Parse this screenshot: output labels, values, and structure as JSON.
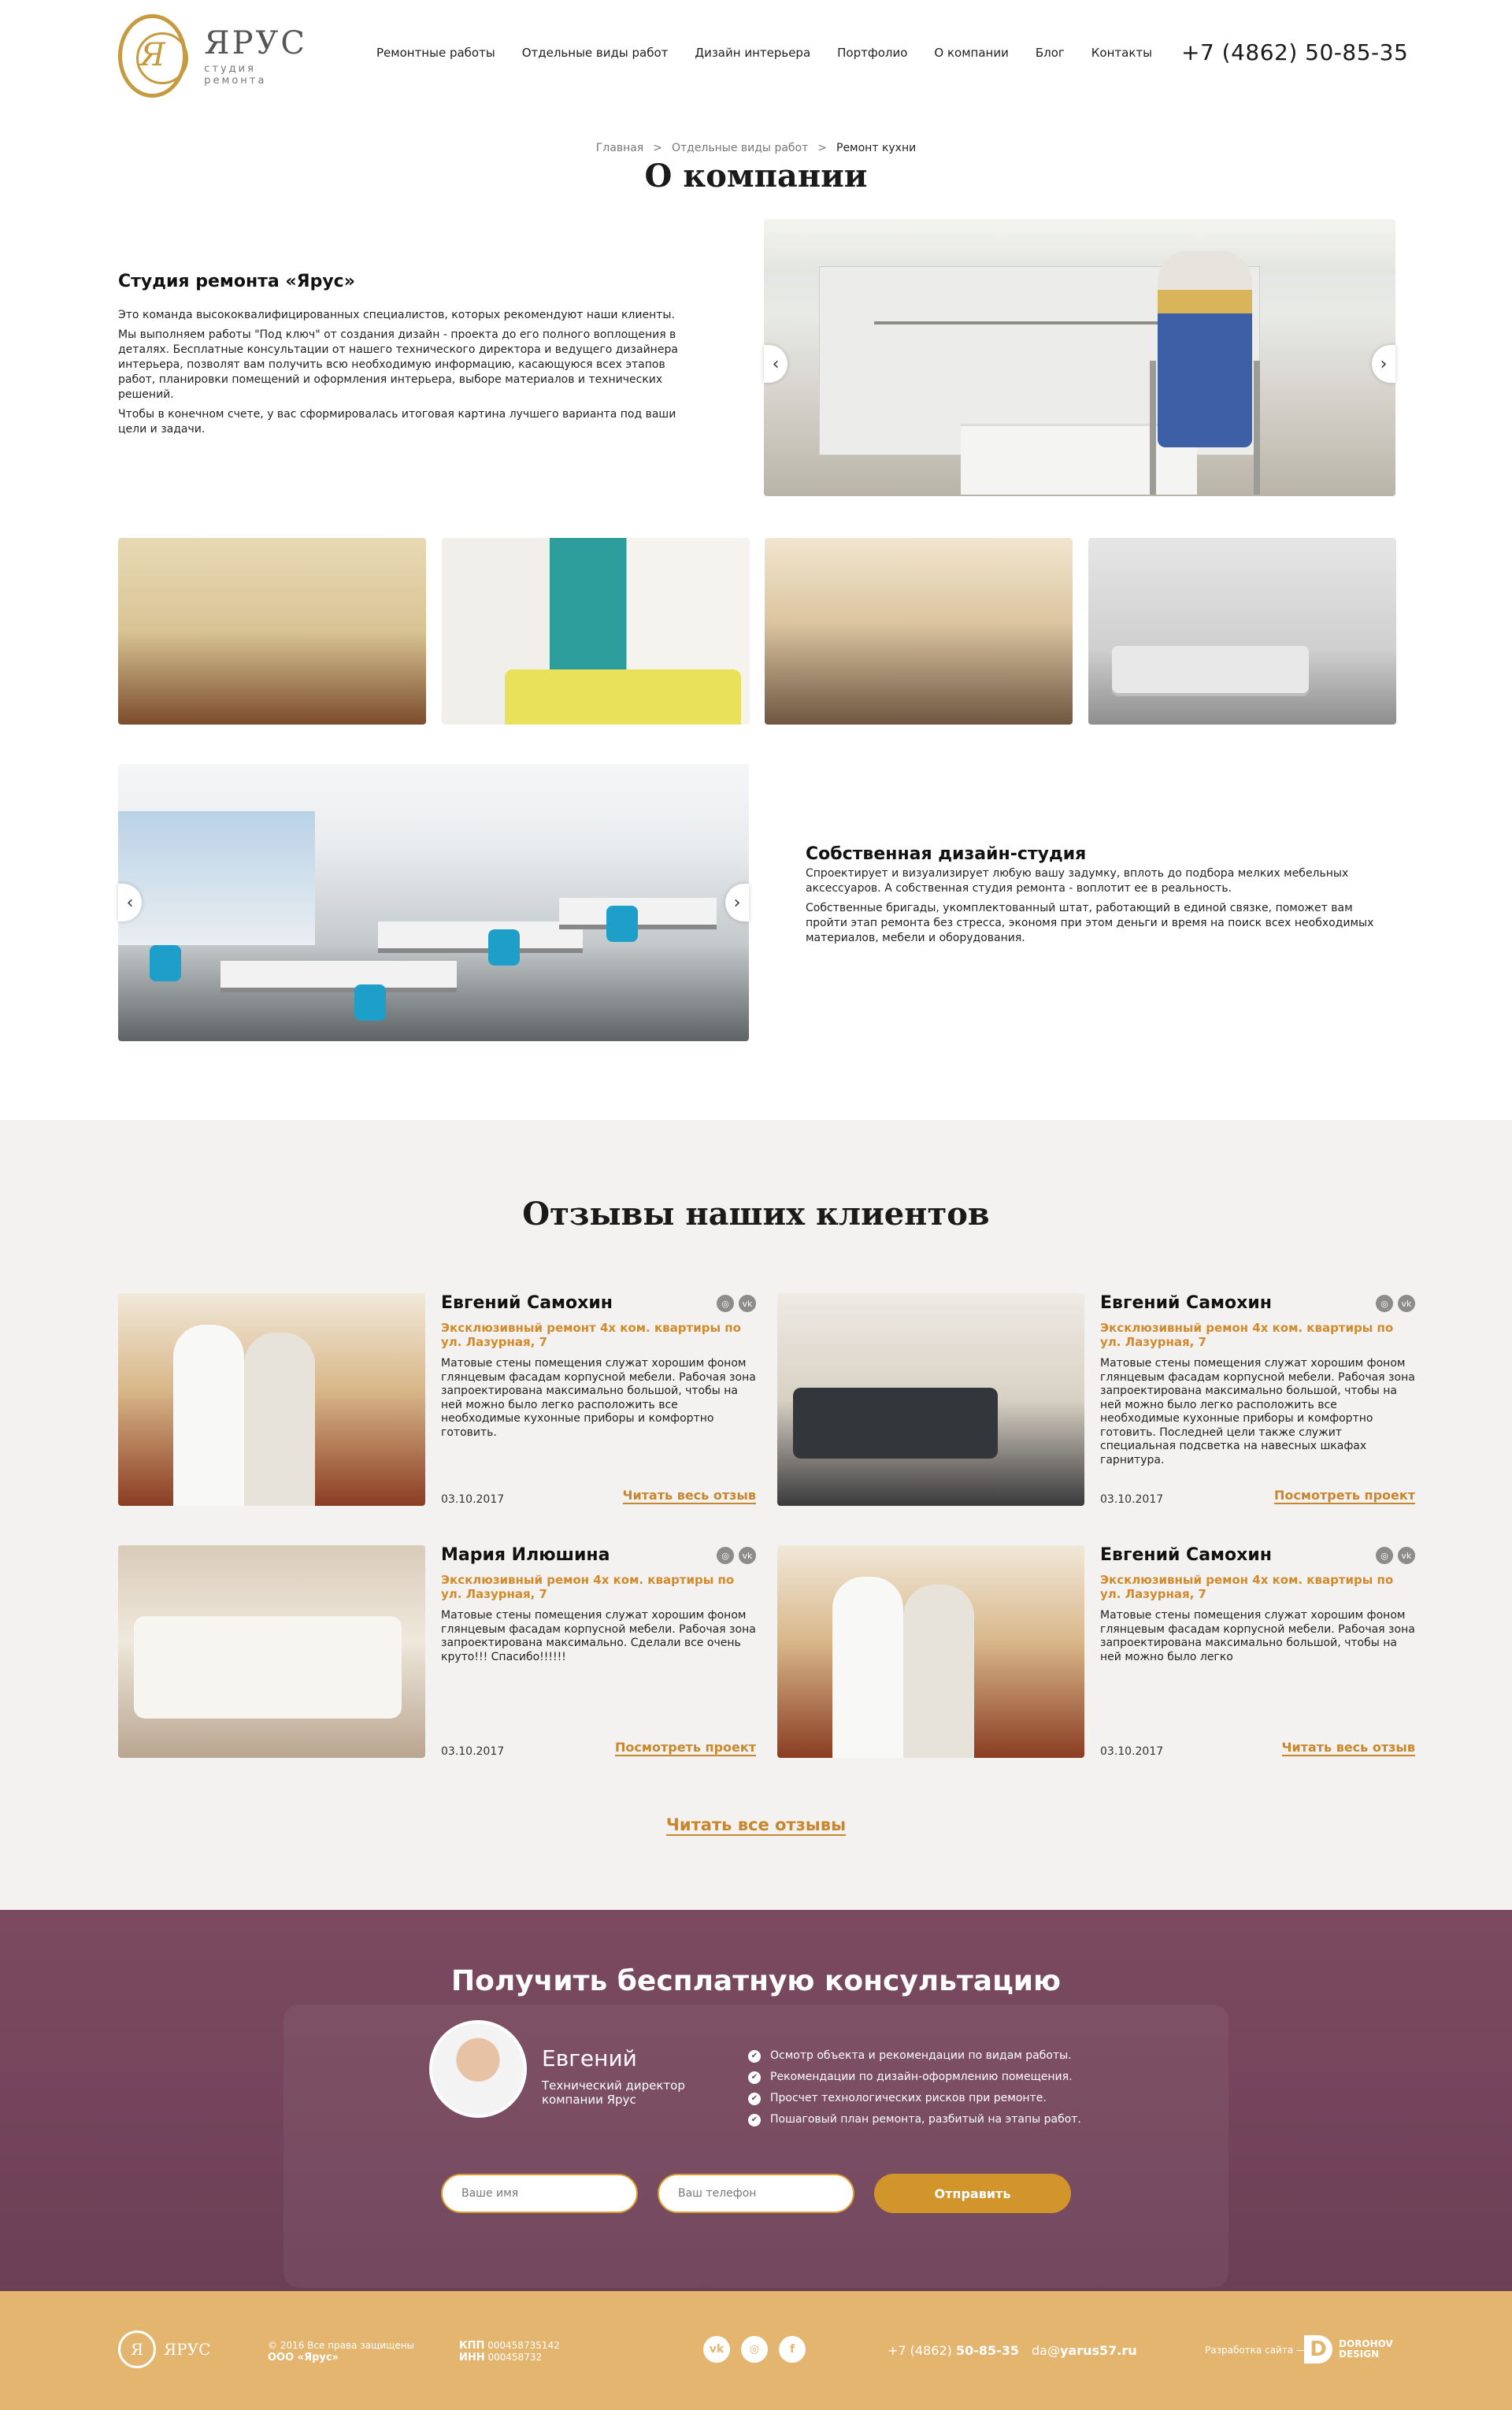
{
  "header": {
    "logo": {
      "name": "ЯРУС",
      "sub": "студия ремонта",
      "mark": "Я"
    },
    "nav": [
      "Ремонтные работы",
      "Отдельные виды работ",
      "Дизайн интерьера",
      "Портфолио",
      "О компании",
      "Блог",
      "Контакты"
    ],
    "phone": "+7 (4862) 50-85-35"
  },
  "breadcrumb": {
    "items": [
      "Главная",
      "Отдельные виды работ",
      "Ремонт кухни"
    ],
    "sep": ">"
  },
  "page_title": "О компании",
  "about": {
    "title": "Студия ремонта «Ярус»",
    "p1": "Это команда высококвалифицированных специалистов, которых рекомендуют наши клиенты.",
    "p2": "Мы выполняем работы \"Под ключ\" от создания дизайн - проекта до его полного воплощения в деталях. Бесплатные консультации от нашего технического директора и ведущего дизайнера интерьера, позволят вам получить всю необходимую информацию, касающуюся всех этапов работ, планировки помещений     и оформления интерьера, выборе материалов и технических решений.",
    "p3": "Чтобы в конечном счете, у вас сформировалась итоговая картина лучшего варианта под ваши цели и задачи."
  },
  "design_studio": {
    "title": "Собственная дизайн-студия",
    "p1": "Спроектирует и визуализирует любую вашу задумку, вплоть до подбора мелких мебельных аксессуаров.  А собственная студия ремонта - воплотит ее в реальность.",
    "p2": "Собственные бригады, укомплектованный штат, работающий в единой связке, поможет вам пройти этап ремонта без стресса, экономя при этом деньги и время на поиск всех необходимых материалов, мебели и оборудования."
  },
  "arrows": {
    "left": "‹",
    "right": "›"
  },
  "reviews": {
    "title": "Отзывы наших клиентов",
    "items": [
      {
        "name": "Евгений Самохин",
        "subtitle": "Эксклюзивный ремонт 4х ком. квартиры по ул. Лазурная, 7",
        "text": "Матовые стены помещения служат хорошим фоном глянцевым фасадам корпусной мебели. Рабочая зона запроектирована максимально большой, чтобы на ней можно было легко расположить все необходимые кухонные приборы и комфортно готовить.",
        "date": "03.10.2017",
        "link": "Читать весь отзыв"
      },
      {
        "name": "Евгений Самохин",
        "subtitle": "Эксклюзивный ремон 4х ком. квартиры по ул. Лазурная, 7",
        "text": "Матовые стены помещения служат хорошим фоном глянцевым фасадам корпусной мебели. Рабочая зона запроектирована максимально большой, чтобы на ней можно было легко расположить все необходимые кухонные приборы и комфортно готовить. Последней цели также служит специальная подсветка на навесных шкафах гарнитура.",
        "date": "03.10.2017",
        "link": "Посмотреть проект"
      },
      {
        "name": "Мария Илюшина",
        "subtitle": "Эксклюзивный ремон 4х ком. квартиры по ул. Лазурная, 7",
        "text": "Матовые стены помещения служат хорошим фоном глянцевым фасадам корпусной мебели. Рабочая зона запроектирована максимально. Сделали все очень круто!!! Спасибо!!!!!!",
        "date": "03.10.2017",
        "link": "Посмотреть проект"
      },
      {
        "name": "Евгений Самохин",
        "subtitle": "Эксклюзивный ремон 4х ком. квартиры по ул. Лазурная, 7",
        "text": "Матовые стены помещения служат хорошим фоном глянцевым фасадам корпусной мебели. Рабочая зона запроектирована максимально большой, чтобы на ней можно было легко",
        "date": "03.10.2017",
        "link": "Читать весь отзыв"
      }
    ],
    "read_all": "Читать все отзывы",
    "social_icons": {
      "instagram": "◎",
      "vk": "vk"
    }
  },
  "consult": {
    "title": "Получить бесплатную консультацию",
    "person_name": "Евгений",
    "person_role": "Технический директор компании Ярус",
    "checks": [
      "Осмотр объекта и рекомендации по видам работы.",
      "Рекомендации по дизайн-оформлению помещения.",
      "Просчет технологических рисков при ремонте.",
      "Пошаговый план ремонта, разбитый на этапы работ."
    ],
    "name_placeholder": "Ваше имя",
    "phone_placeholder": "Ваш телефон",
    "send": "Отправить"
  },
  "footer": {
    "logo_name": "ЯРУС",
    "logo_mark": "Я",
    "copyright": "© 2016 Все права защищены",
    "org": "ООО «Ярус»",
    "kpp_label": "КПП",
    "kpp": "000458735142",
    "inn_label": "ИНН",
    "inn": "000458732",
    "social": [
      "vk",
      "◎",
      "f"
    ],
    "phone_prefix": "+7 (4862)",
    "phone_num": "50-85-35",
    "email_prefix": "da@",
    "email_domain": "yarus57.ru",
    "dev_label": "Разработка сайта —",
    "dev_mark": "D",
    "dev_name1": "DOROHOV",
    "dev_name2": "DESIGN"
  },
  "colors": {
    "accent": "#c8862d",
    "brand_gold": "#c69a3f",
    "consult_bg": "#6c3f56",
    "footer_bg": "#e3b56f"
  }
}
